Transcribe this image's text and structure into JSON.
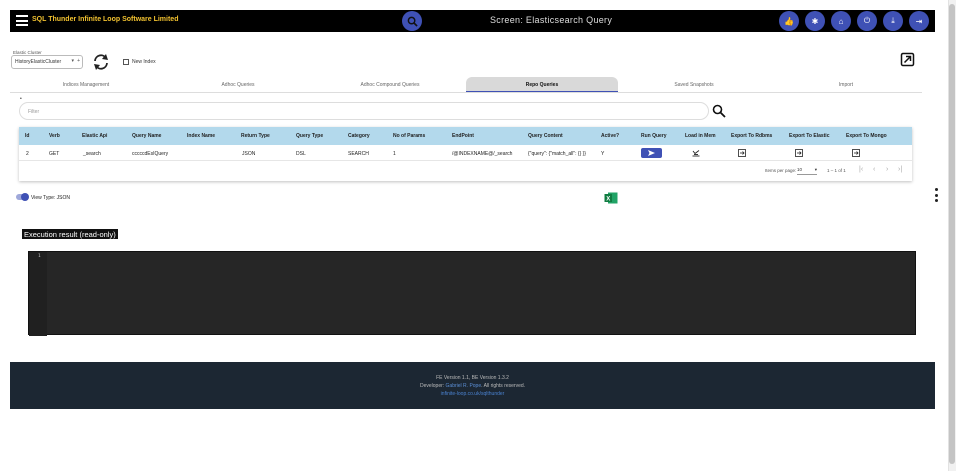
{
  "app": {
    "title": "SQL Thunder Infinite Loop Software Limited",
    "screen_title": "Screen:  Elasticsearch Query"
  },
  "top_actions": [
    {
      "icon": "thumbs-up-icon",
      "glyph": "👍"
    },
    {
      "icon": "asterisk-icon",
      "glyph": "✱"
    },
    {
      "icon": "home-icon",
      "glyph": "⌂"
    },
    {
      "icon": "power-icon",
      "glyph": "⏻"
    },
    {
      "icon": "download-icon",
      "glyph": "⤓"
    },
    {
      "icon": "logout-icon",
      "glyph": "⇥"
    }
  ],
  "cluster": {
    "label": "Elastic Cluster",
    "value": "HistoryElasticCluster",
    "add_glyph": "+"
  },
  "new_index_label": "New Index",
  "tabs": [
    {
      "label": "Indices Management",
      "active": false
    },
    {
      "label": "Adhoc Queries",
      "active": false
    },
    {
      "label": "Adhoc Compound Queries",
      "active": false
    },
    {
      "label": "Repo Queries",
      "active": true
    },
    {
      "label": "Saved Snapshots",
      "active": false
    },
    {
      "label": "Import",
      "active": false
    }
  ],
  "filter": {
    "placeholder": "Filter"
  },
  "table": {
    "headers": [
      "Id",
      "Verb",
      "Elastic Api",
      "Query Name",
      "Index Name",
      "Return Type",
      "Query Type",
      "Category",
      "No of Params",
      "EndPoint",
      "Query Content",
      "Active?",
      "Run Query",
      "Load in Mem",
      "Export To Rdbms",
      "Export To Elastic",
      "Export To Mongo"
    ],
    "rows": [
      {
        "id": "2",
        "verb": "GET",
        "elastic_api": "_search",
        "query_name": "cccccdEsIQuery",
        "index_name": "",
        "return_type": "JSON",
        "query_type": "DSL",
        "category": "SEARCH",
        "no_of_params": "1",
        "endpoint": "/@INDEXNAME@/_search",
        "query_content": "{\"query\": {\"match_all\": {} }}",
        "active": "Y"
      }
    ],
    "paginator": {
      "items_per_page_label": "Items per page:",
      "items_per_page": "10",
      "range": "1 – 1 of 1"
    }
  },
  "view_type_label": "View Type: JSON",
  "execution_label": "Execution result (read-only)",
  "editor": {
    "line_number": "1"
  },
  "footer": {
    "version": "FE Version 1.1, BE Version 1.3.2",
    "developer_prefix": "Developer: ",
    "developer_name": "Gabriel R. Pope",
    "developer_suffix": ". All rights reserved.",
    "link": "infinite-loop.co.uk/sqlthunder"
  }
}
